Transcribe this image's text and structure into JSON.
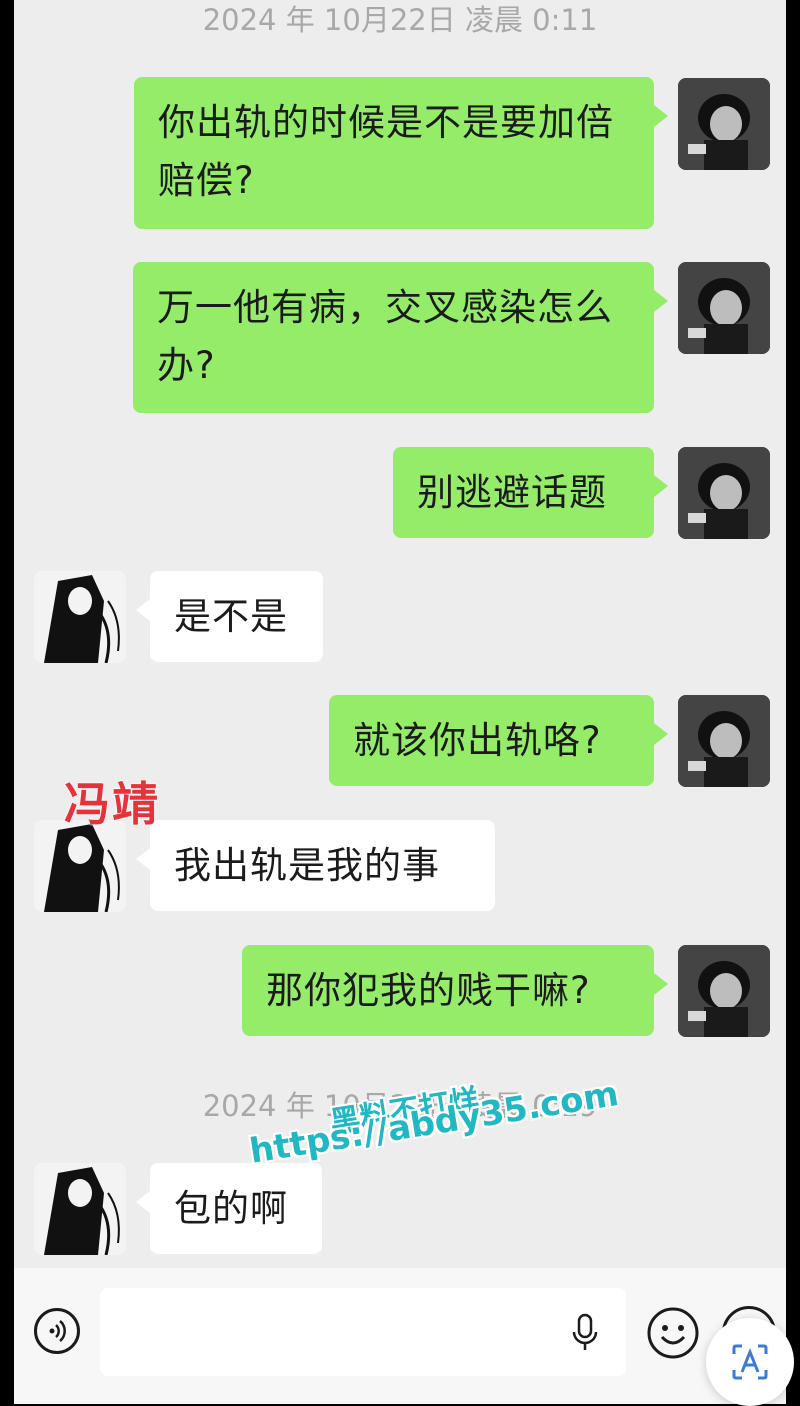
{
  "timestamps": [
    "2024 年 10月22日 凌晨 0:11",
    "2024 年 10月22日 凌晨 0:19"
  ],
  "messages": [
    {
      "side": "out",
      "text": "你出轨的时候是不是要加倍赔偿?"
    },
    {
      "side": "out",
      "text": "万一他有病，交叉感染怎么办?"
    },
    {
      "side": "out",
      "text": "别逃避话题"
    },
    {
      "side": "in",
      "text": "是不是"
    },
    {
      "side": "out",
      "text": "就该你出轨咯?"
    },
    {
      "side": "in",
      "text": "我出轨是我的事"
    },
    {
      "side": "out",
      "text": "那你犯我的贱干嘛?"
    },
    {
      "side": "in",
      "text": "包的啊"
    }
  ],
  "overlay_label": "冯靖",
  "watermark": {
    "line1": "黑料不打烊",
    "line2": "https://abdy35.com"
  },
  "colors": {
    "outgoing_bubble": "#95ec69",
    "incoming_bubble": "#ffffff",
    "chat_background": "#ededed",
    "label_red": "#e5333c",
    "watermark": "#21b8c4"
  },
  "input_bar": {
    "placeholder": "",
    "voice_icon": "voice-icon",
    "mic_icon": "microphone-icon",
    "emoji_icon": "emoji-icon",
    "plus_icon": "plus-icon"
  },
  "floating_button": {
    "icon": "text-recognition-icon"
  }
}
